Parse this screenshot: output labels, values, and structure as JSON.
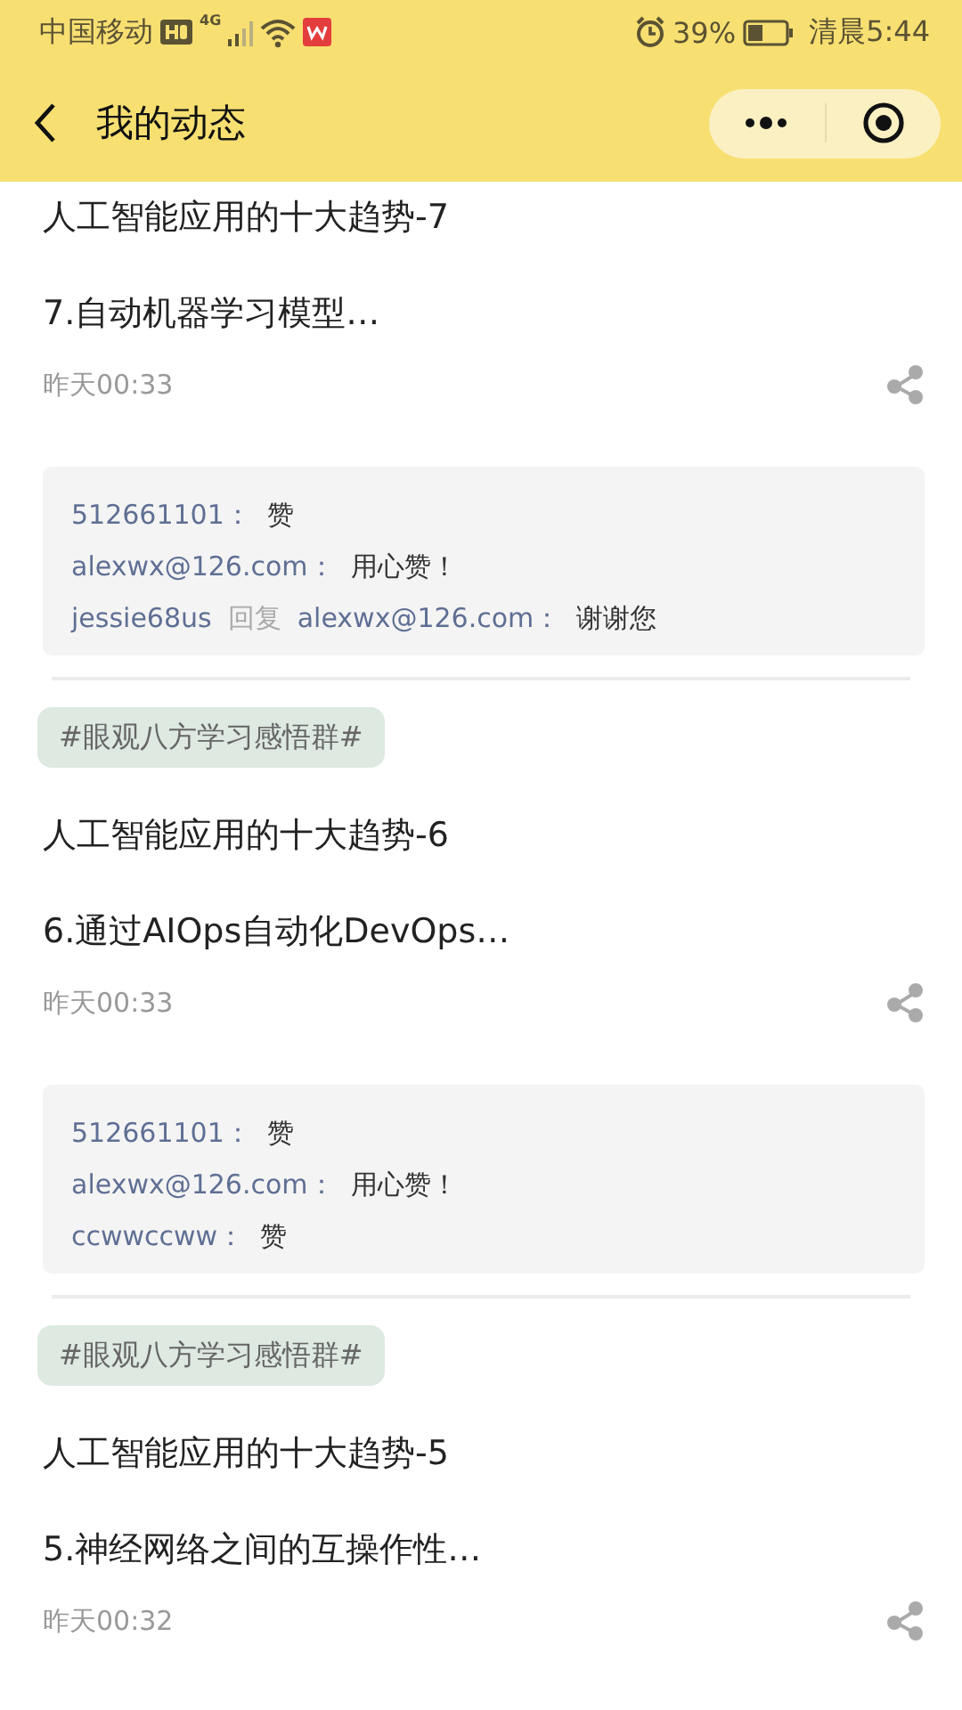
{
  "status_bar": {
    "carrier": "中国移动",
    "network": "4G",
    "battery": "39%",
    "time": "清晨5:44"
  },
  "nav": {
    "title": "我的动态"
  },
  "posts": [
    {
      "title": "人工智能应用的十大趋势-7",
      "summary": "7.自动机器学习模型…",
      "time": "昨天00:33",
      "comments": [
        {
          "kind": "comment",
          "user": "512661101：",
          "text": "赞"
        },
        {
          "kind": "comment",
          "user": "alexwx@126.com：",
          "text": "用心赞！"
        },
        {
          "kind": "reply",
          "user": "jessie68us",
          "reply_label": "回复",
          "target": "alexwx@126.com：",
          "text": "谢谢您"
        }
      ]
    },
    {
      "tag": "#眼观八方学习感悟群#",
      "title": "人工智能应用的十大趋势-6",
      "summary": "6.通过AIOps自动化DevOps…",
      "time": "昨天00:33",
      "comments": [
        {
          "kind": "comment",
          "user": "512661101：",
          "text": "赞"
        },
        {
          "kind": "comment",
          "user": "alexwx@126.com：",
          "text": "用心赞！"
        },
        {
          "kind": "comment",
          "user": "ccwwccww：",
          "text": "赞"
        }
      ]
    },
    {
      "tag": "#眼观八方学习感悟群#",
      "title": "人工智能应用的十大趋势-5",
      "summary": "5.神经网络之间的互操作性…",
      "time": "昨天00:32"
    }
  ]
}
